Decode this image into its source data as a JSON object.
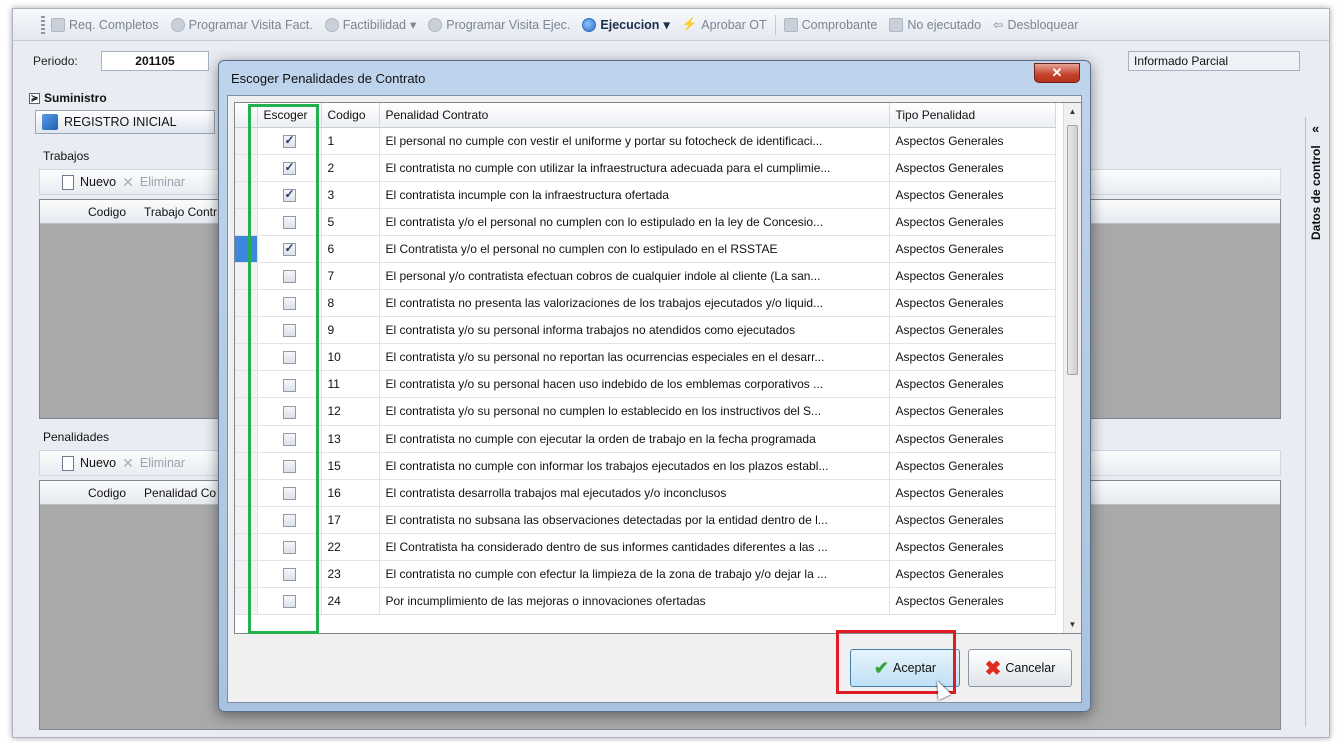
{
  "toolbar": {
    "items": [
      "Req. Completos",
      "Programar Visita Fact.",
      "Factibilidad",
      "Programar Visita Ejec.",
      "Ejecucion",
      "Aprobar OT",
      "Comprobante",
      "No ejecutado",
      "Desbloquear"
    ],
    "dropdown_marker": "▾"
  },
  "header": {
    "periodo_label": "Periodo:",
    "periodo_value": "201105",
    "estado_value": "Informado Parcial"
  },
  "suministro": {
    "label": "Suministro",
    "toggle": "≽"
  },
  "registro_tab": "REGISTRO INICIAL",
  "trabajos": {
    "label": "Trabajos",
    "nuevo": "Nuevo",
    "eliminar": "Eliminar",
    "col_codigo": "Codigo",
    "col_trabajo": "Trabajo Contr"
  },
  "penalidades": {
    "label": "Penalidades",
    "nuevo": "Nuevo",
    "eliminar": "Eliminar",
    "col_codigo": "Codigo",
    "col_penalidad": "Penalidad Co"
  },
  "side_panel": {
    "chevron": "«",
    "label": "Datos de control"
  },
  "dialog": {
    "title": "Escoger Penalidades de Contrato",
    "close": "✕",
    "columns": [
      "Escoger",
      "Codigo",
      "Penalidad Contrato",
      "Tipo Penalidad"
    ],
    "rows": [
      {
        "checked": true,
        "codigo": "1",
        "penalidad": "El personal no cumple con vestir el uniforme y portar su fotocheck de identificaci...",
        "tipo": "Aspectos Generales"
      },
      {
        "checked": true,
        "codigo": "2",
        "penalidad": "El contratista no cumple con utilizar la infraestructura adecuada para el cumplimie...",
        "tipo": "Aspectos Generales"
      },
      {
        "checked": true,
        "codigo": "3",
        "penalidad": "El contratista incumple con la infraestructura ofertada",
        "tipo": "Aspectos Generales"
      },
      {
        "checked": false,
        "codigo": "5",
        "penalidad": "El contratista y/o el personal no cumplen con lo estipulado en la ley de Concesio...",
        "tipo": "Aspectos Generales"
      },
      {
        "checked": true,
        "codigo": "6",
        "penalidad": "El Contratista y/o el personal no cumplen con lo estipulado en el RSSTAE",
        "tipo": "Aspectos Generales",
        "selected": true
      },
      {
        "checked": false,
        "codigo": "7",
        "penalidad": "El personal y/o contratista efectuan cobros de cualquier indole al cliente (La san...",
        "tipo": "Aspectos Generales"
      },
      {
        "checked": false,
        "codigo": "8",
        "penalidad": "El contratista no presenta las valorizaciones de los trabajos ejecutados y/o liquid...",
        "tipo": "Aspectos Generales"
      },
      {
        "checked": false,
        "codigo": "9",
        "penalidad": "El contratista y/o su personal informa trabajos no atendidos como ejecutados",
        "tipo": "Aspectos Generales"
      },
      {
        "checked": false,
        "codigo": "10",
        "penalidad": "El contratista y/o su personal no reportan las ocurrencias especiales en el desarr...",
        "tipo": "Aspectos Generales"
      },
      {
        "checked": false,
        "codigo": "11",
        "penalidad": "El contratista y/o su personal hacen uso indebido de los emblemas corporativos ...",
        "tipo": "Aspectos Generales"
      },
      {
        "checked": false,
        "codigo": "12",
        "penalidad": "El contratista y/o su personal no cumplen lo establecido en los instructivos del S...",
        "tipo": "Aspectos Generales"
      },
      {
        "checked": false,
        "codigo": "13",
        "penalidad": "El contratista no cumple con ejecutar la orden de trabajo en la fecha programada",
        "tipo": "Aspectos Generales"
      },
      {
        "checked": false,
        "codigo": "15",
        "penalidad": "El contratista no cumple con informar los trabajos ejecutados en los plazos establ...",
        "tipo": "Aspectos Generales"
      },
      {
        "checked": false,
        "codigo": "16",
        "penalidad": "El contratista desarrolla trabajos mal ejecutados y/o inconclusos",
        "tipo": "Aspectos Generales"
      },
      {
        "checked": false,
        "codigo": "17",
        "penalidad": "El contratista no subsana las observaciones detectadas por la entidad dentro de l...",
        "tipo": "Aspectos Generales"
      },
      {
        "checked": false,
        "codigo": "22",
        "penalidad": "El Contratista ha considerado dentro de sus informes cantidades diferentes a las ...",
        "tipo": "Aspectos Generales"
      },
      {
        "checked": false,
        "codigo": "23",
        "penalidad": "El contratista no cumple con efectur la limpieza de la zona de trabajo y/o dejar la ...",
        "tipo": "Aspectos Generales"
      },
      {
        "checked": false,
        "codigo": "24",
        "penalidad": "Por incumplimiento de las mejoras o innovaciones ofertadas",
        "tipo": "Aspectos Generales"
      }
    ],
    "aceptar": "Aceptar",
    "cancelar": "Cancelar"
  },
  "colors": {
    "highlight_green": "#22b14c",
    "highlight_red": "#e01b24",
    "selection": "#3d86dd"
  }
}
